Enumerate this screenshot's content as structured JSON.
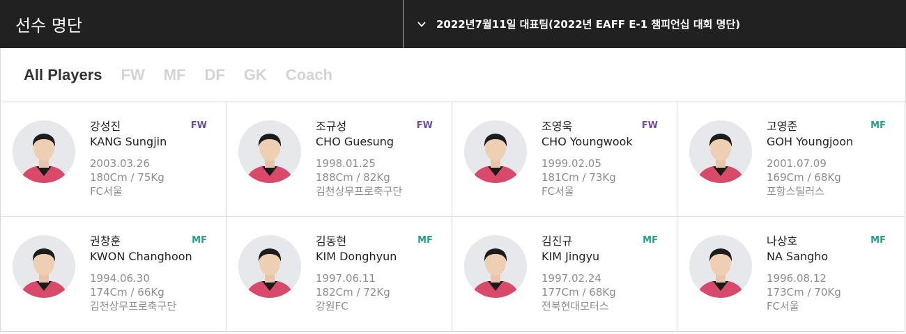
{
  "header": {
    "title": "선수 명단",
    "roster_select": "2022년7월11일 대표팀(2022년 EAFF E-1 챔피언십 대회 명단)"
  },
  "tabs": [
    {
      "label": "All Players",
      "active": true
    },
    {
      "label": "FW",
      "active": false
    },
    {
      "label": "MF",
      "active": false
    },
    {
      "label": "DF",
      "active": false
    },
    {
      "label": "GK",
      "active": false
    },
    {
      "label": "Coach",
      "active": false
    }
  ],
  "colors": {
    "fw": "#6a4aa6",
    "mf": "#1fa288",
    "dark": "#212121",
    "kit": "#d94a6a"
  },
  "players": [
    {
      "name_ko": "강성진",
      "name_en": "KANG Sungjin",
      "birth": "2003.03.26",
      "body": "180Cm / 75Kg",
      "club": "FC서울",
      "position": "FW"
    },
    {
      "name_ko": "조규성",
      "name_en": "CHO Guesung",
      "birth": "1998.01.25",
      "body": "188Cm / 82Kg",
      "club": "김천상무프로축구단",
      "position": "FW"
    },
    {
      "name_ko": "조영욱",
      "name_en": "CHO Youngwook",
      "birth": "1999.02.05",
      "body": "181Cm / 73Kg",
      "club": "FC서울",
      "position": "FW"
    },
    {
      "name_ko": "고영준",
      "name_en": "GOH Youngjoon",
      "birth": "2001.07.09",
      "body": "169Cm / 68Kg",
      "club": "포항스틸러스",
      "position": "MF"
    },
    {
      "name_ko": "권창훈",
      "name_en": "KWON Changhoon",
      "birth": "1994.06.30",
      "body": "174Cm / 66Kg",
      "club": "김천상무프로축구단",
      "position": "MF"
    },
    {
      "name_ko": "김동현",
      "name_en": "KIM Donghyun",
      "birth": "1997.06.11",
      "body": "182Cm / 72Kg",
      "club": "강원FC",
      "position": "MF"
    },
    {
      "name_ko": "김진규",
      "name_en": "KIM Jingyu",
      "birth": "1997.02.24",
      "body": "177Cm / 68Kg",
      "club": "전북현대모터스",
      "position": "MF"
    },
    {
      "name_ko": "나상호",
      "name_en": "NA Sangho",
      "birth": "1996.08.12",
      "body": "173Cm / 70Kg",
      "club": "FC서울",
      "position": "MF"
    }
  ]
}
